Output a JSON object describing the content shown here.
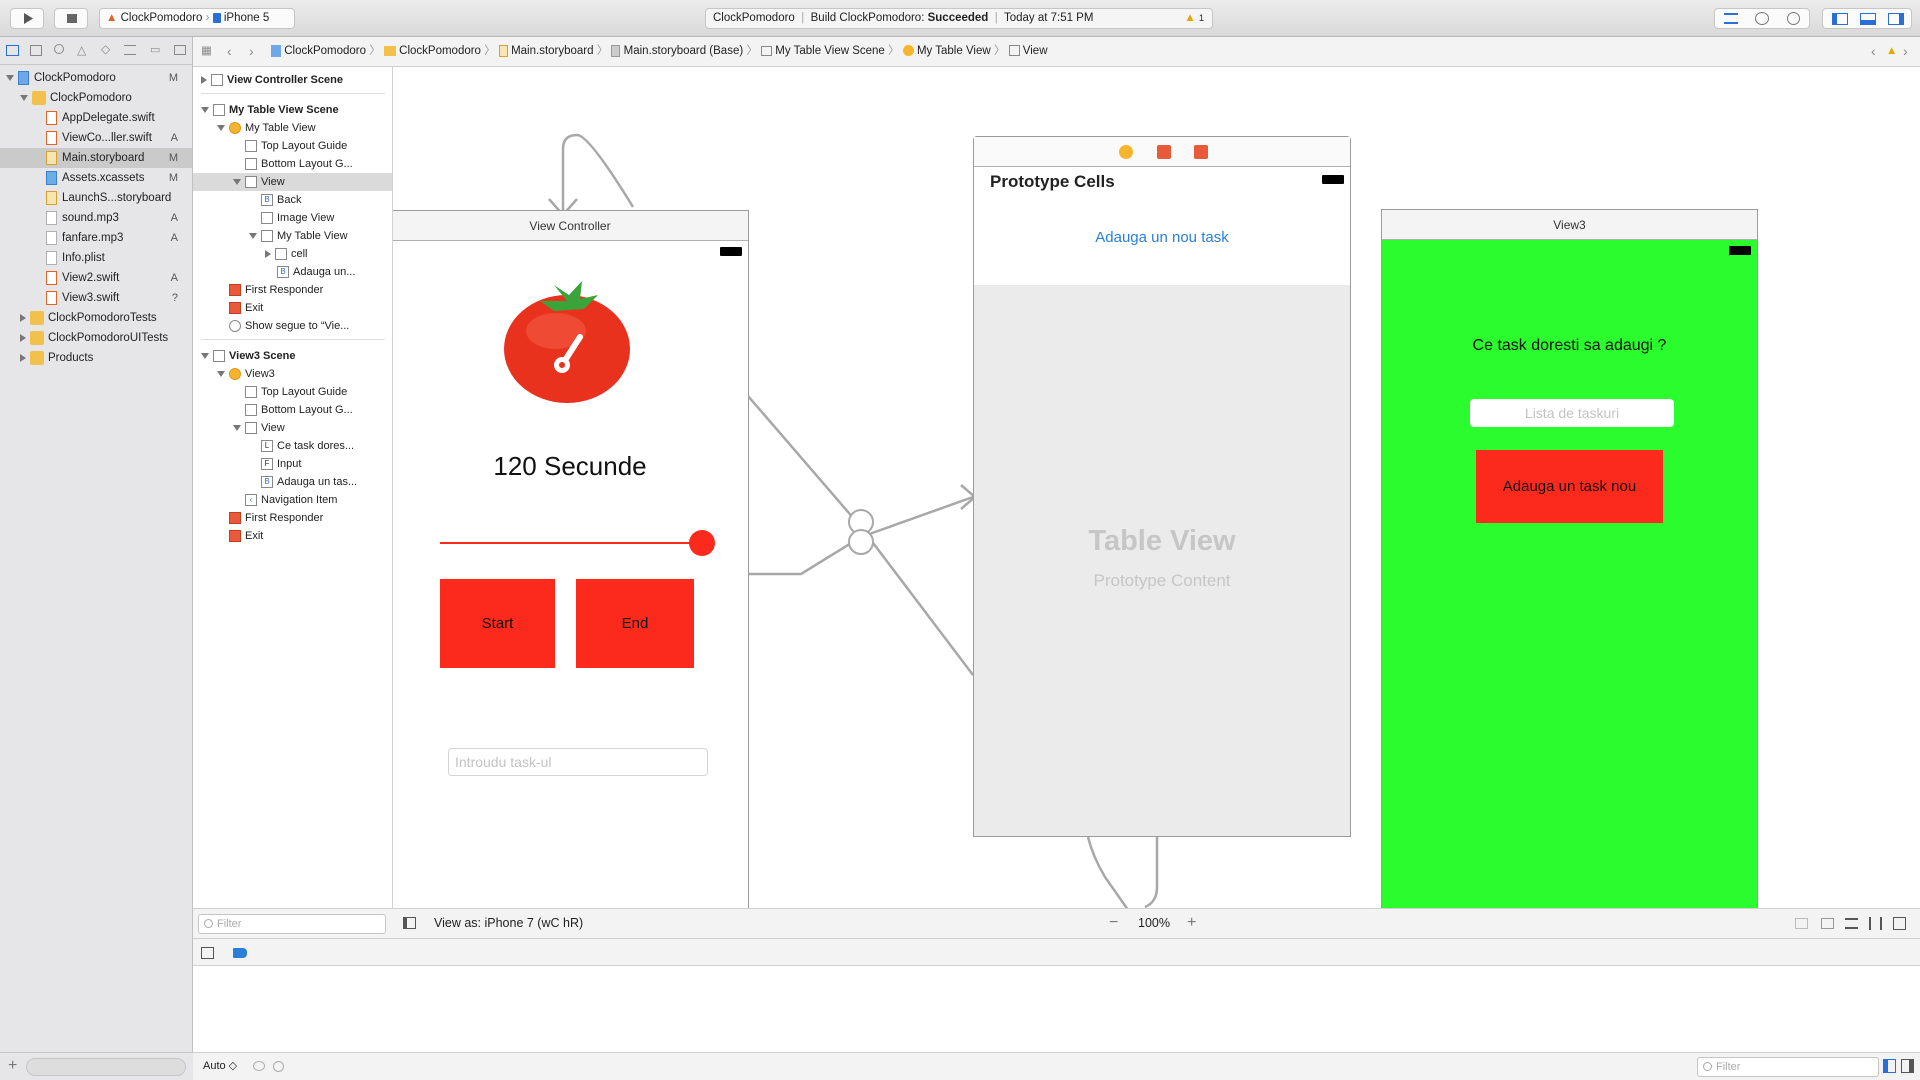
{
  "toolbar": {
    "scheme_project": "ClockPomodoro",
    "scheme_device": "iPhone 5",
    "activity_project": "ClockPomodoro",
    "activity_build_prefix": "Build ClockPomodoro:",
    "activity_build_status": "Succeeded",
    "activity_time": "Today at 7:51 PM",
    "warning_count": "1"
  },
  "navigator": {
    "items": [
      {
        "label": "ClockPomodoro",
        "badge": "M"
      },
      {
        "label": "ClockPomodoro",
        "badge": ""
      },
      {
        "label": "AppDelegate.swift",
        "badge": ""
      },
      {
        "label": "ViewCo...ller.swift",
        "badge": "A"
      },
      {
        "label": "Main.storyboard",
        "badge": "M"
      },
      {
        "label": "Assets.xcassets",
        "badge": "M"
      },
      {
        "label": "LaunchS...storyboard",
        "badge": ""
      },
      {
        "label": "sound.mp3",
        "badge": "A"
      },
      {
        "label": "fanfare.mp3",
        "badge": "A"
      },
      {
        "label": "Info.plist",
        "badge": ""
      },
      {
        "label": "View2.swift",
        "badge": "A"
      },
      {
        "label": "View3.swift",
        "badge": "?"
      },
      {
        "label": "ClockPomodoroTests",
        "badge": ""
      },
      {
        "label": "ClockPomodoroUITests",
        "badge": ""
      },
      {
        "label": "Products",
        "badge": ""
      }
    ]
  },
  "jumpbar": {
    "crumbs": [
      "ClockPomodoro",
      "ClockPomodoro",
      "Main.storyboard",
      "Main.storyboard (Base)",
      "My Table View Scene",
      "My Table View",
      "View"
    ]
  },
  "outline": {
    "rows": [
      "View Controller Scene",
      "My Table View Scene",
      "My Table View",
      "Top Layout Guide",
      "Bottom Layout G...",
      "View",
      "Back",
      "Image View",
      "My Table View",
      "cell",
      "Adauga un...",
      "First Responder",
      "Exit",
      "Show segue to “Vie...",
      "View3 Scene",
      "View3",
      "Top Layout Guide",
      "Bottom Layout G...",
      "View",
      "Ce task dores...",
      "Input",
      "Adauga un tas...",
      "Navigation Item",
      "First Responder",
      "Exit"
    ],
    "filter_placeholder": "Filter"
  },
  "canvas": {
    "vc": {
      "title": "View Controller",
      "seconds": "120 Secunde",
      "start": "Start",
      "end": "End",
      "task_placeholder": "Introudu task-ul",
      "slider_value": 1.0
    },
    "table": {
      "prototype_cells": "Prototype Cells",
      "add_task": "Adauga un nou task",
      "table_view": "Table View",
      "prototype_content": "Prototype Content"
    },
    "view3": {
      "title": "View3",
      "question": "Ce task doresti sa adaugi ?",
      "input_placeholder": "Lista de taskuri",
      "button": "Adauga un task nou",
      "bg_color": "#2afc2e"
    }
  },
  "canvasbar": {
    "view_as": "View as: iPhone 7 (wC hR)",
    "zoom": "100%"
  },
  "bottombar": {
    "auto_label": "Auto ◇",
    "filter_placeholder": "Filter"
  },
  "colors": {
    "accent_red": "#fc2a1c",
    "link_blue": "#2a7fd8",
    "view3_green": "#2afc2e"
  }
}
